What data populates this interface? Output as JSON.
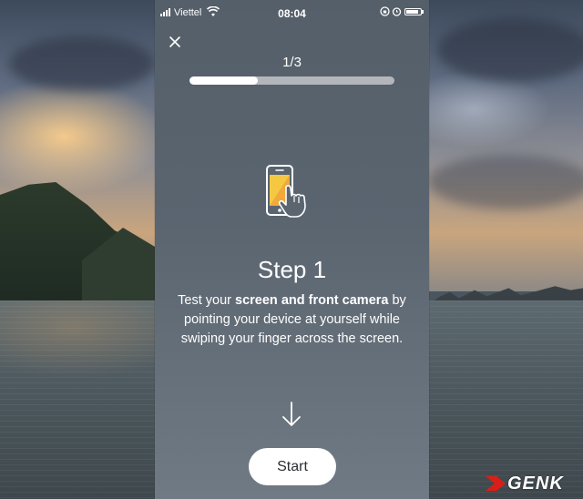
{
  "status_bar": {
    "carrier": "Viettel",
    "time": "08:04"
  },
  "onboarding": {
    "step_counter": "1/3",
    "progress_fraction": 0.333,
    "title": "Step 1",
    "description_pre": "Test your ",
    "description_bold": "screen and front camera",
    "description_post": " by pointing your device at yourself while swiping your finger across the screen.",
    "start_label": "Start",
    "illustration_icon": "phone-swipe-icon"
  },
  "watermark": {
    "text": "GENK"
  },
  "colors": {
    "panel": "#5b6570",
    "accent_yellow": "#f5c842",
    "progress_track": "#b3b7bc",
    "watermark_red": "#d91e18"
  }
}
